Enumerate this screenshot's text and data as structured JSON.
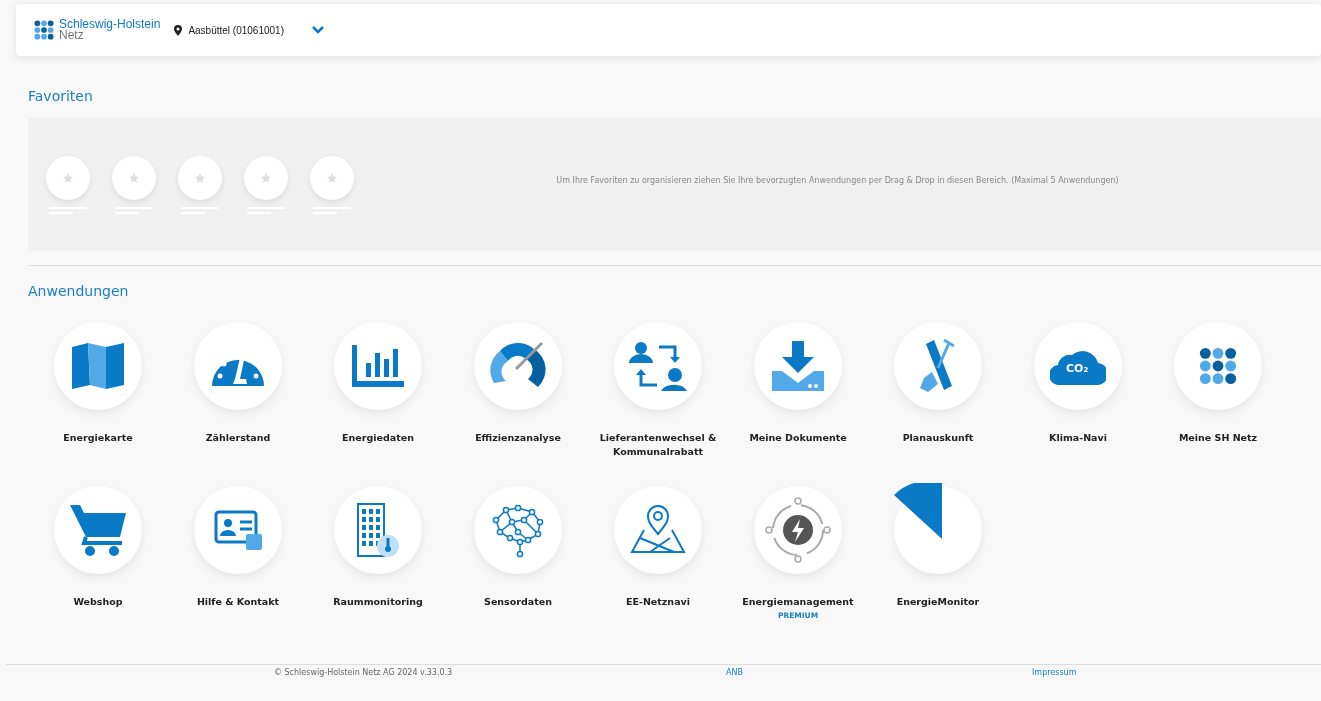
{
  "header": {
    "logo": {
      "line_1": "Schleswig-Holstein",
      "line_2": "Netz"
    },
    "location": "Aasbüttel (01061001)"
  },
  "favorites": {
    "title": "Favoriten",
    "hint": "Um Ihre Favoriten zu organisieren ziehen Sie Ihre bevorzugten Anwendungen per Drag & Drop in diesen Bereich. (Maximal 5 Anwendungen)"
  },
  "applications": {
    "title": "Anwendungen",
    "items": [
      {
        "label": "Energiekarte",
        "kind": "map"
      },
      {
        "label": "Zählerstand",
        "kind": "gauge"
      },
      {
        "label": "Energiedaten",
        "kind": "bars"
      },
      {
        "label": "Effizienzanalyse",
        "kind": "dial"
      },
      {
        "label": "Lieferantenwechsel & Kommunalrabatt",
        "kind": "swap"
      },
      {
        "label": "Meine Dokumente",
        "kind": "download"
      },
      {
        "label": "Planauskunft",
        "kind": "shovel"
      },
      {
        "label": "Klima-Navi",
        "kind": "cloud",
        "icon_text": "CO₂"
      },
      {
        "label": "Meine SH Netz",
        "kind": "dots"
      },
      {
        "label": "Webshop",
        "kind": "cart"
      },
      {
        "label": "Hilfe & Kontakt",
        "kind": "card"
      },
      {
        "label": "Raummonitoring",
        "kind": "building"
      },
      {
        "label": "Sensordaten",
        "kind": "brain"
      },
      {
        "label": "EE-Netznavi",
        "kind": "pin"
      },
      {
        "label": "Energiemanagement",
        "kind": "bolt",
        "badge": "PREMIUM"
      },
      {
        "label": "EnergieMonitor",
        "kind": "wedge"
      }
    ]
  },
  "footer": {
    "copyright": "© Schleswig-Holstein Netz AG 2024 v.33.0.3",
    "links": [
      "ANB",
      "Impressum"
    ]
  }
}
